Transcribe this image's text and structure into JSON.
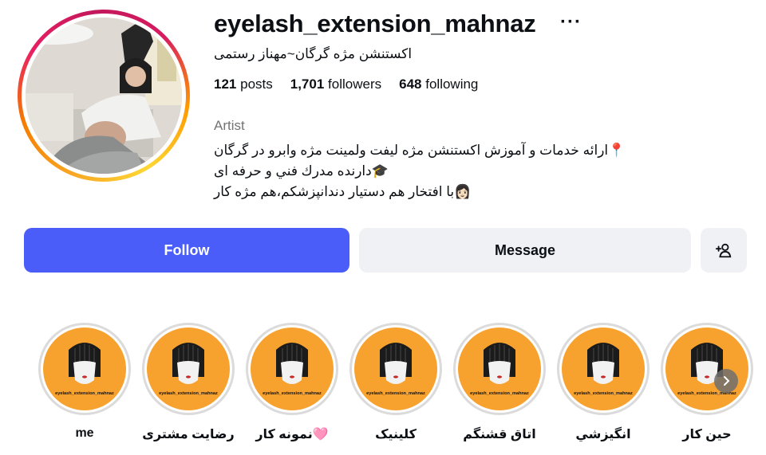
{
  "profile": {
    "username": "eyelash_extension_mahnaz",
    "more_icon": "more-horizontal-icon",
    "full_name": "اکستنشن مژه گرگان~مهناز رستمی",
    "stats": {
      "posts_count": "121",
      "posts_label": "posts",
      "followers_count": "1,701",
      "followers_label": "followers",
      "following_count": "648",
      "following_label": "following"
    },
    "category": "Artist",
    "bio": [
      "📍ارائه خدمات و آموزش اکستنشن مژه لیفت ولمینت مژه وابرو در گرگان",
      "🎓دارنده مدرك فني و حرفه اى",
      "👩🏻با افتخار هم دستیار دندانپزشکم،هم مژه کار"
    ]
  },
  "actions": {
    "follow_label": "Follow",
    "message_label": "Message",
    "add_user_icon": "person-add-icon",
    "follow_color": "#4a5df9"
  },
  "highlights": {
    "cover_text": "eyelash_extension_mahnaz",
    "cover_color": "#f7a12f",
    "items": [
      {
        "label": "me"
      },
      {
        "label": "رضایت مشتری"
      },
      {
        "label": "🩷نمونه کار"
      },
      {
        "label": "کلینیک"
      },
      {
        "label": "اتاق قشنگم"
      },
      {
        "label": "انگیزشي"
      },
      {
        "label": "حین کار"
      }
    ],
    "next_icon": "chevron-right-icon"
  }
}
